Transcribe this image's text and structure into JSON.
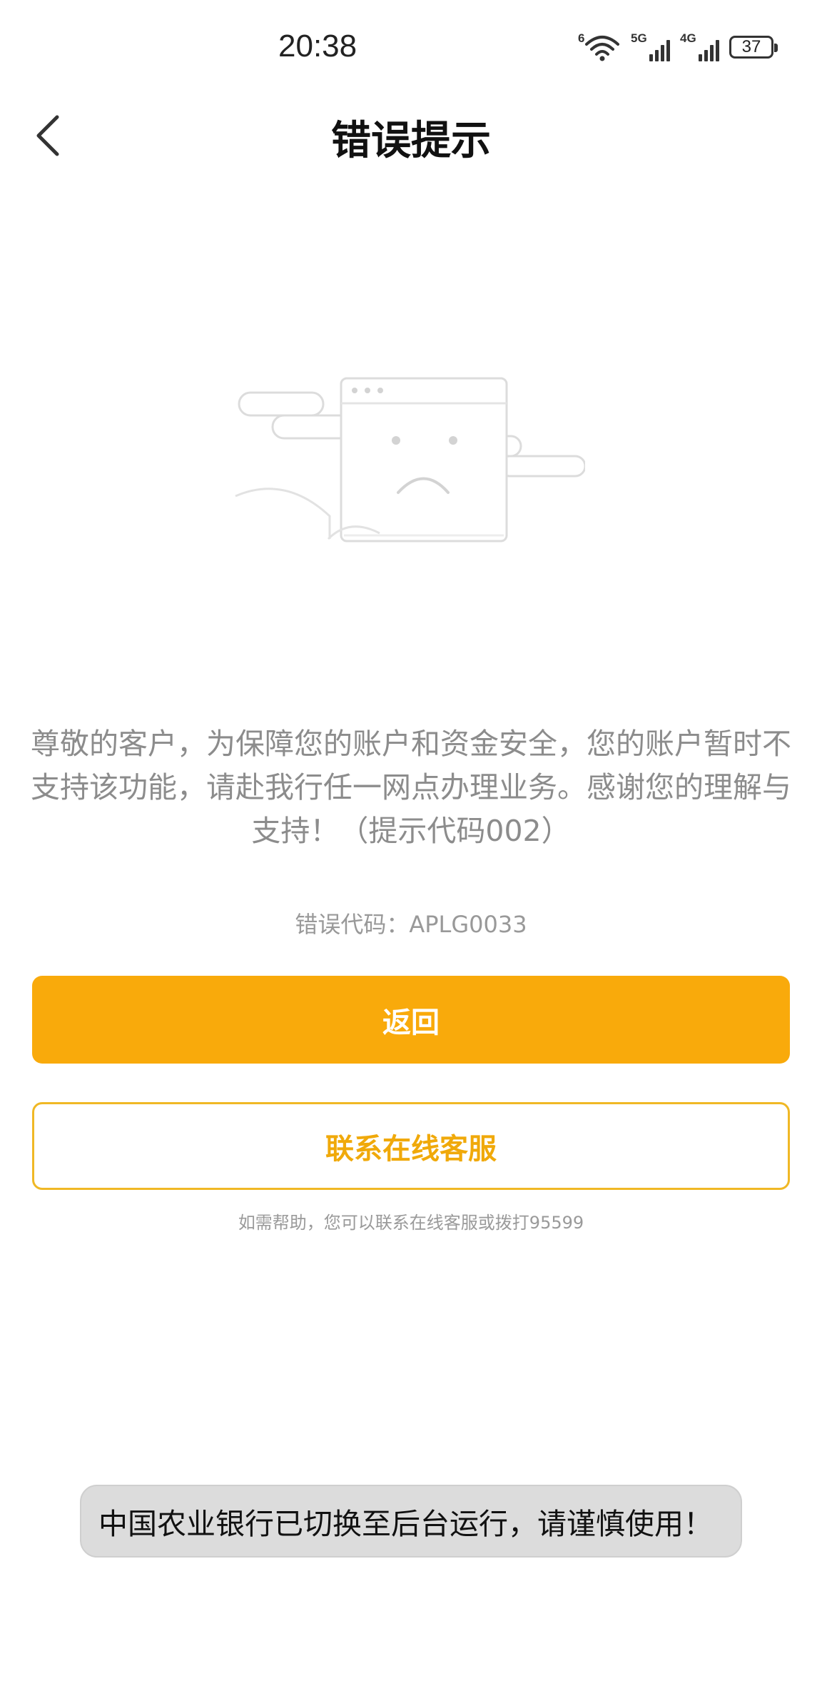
{
  "status_bar": {
    "time": "20:38",
    "wifi_label": "6",
    "sim1_label": "5G",
    "sim2_label": "4G",
    "battery": "37",
    "icons": [
      "wifi-icon",
      "signal-5g-icon",
      "signal-4g-icon",
      "battery-icon"
    ]
  },
  "nav": {
    "title": "错误提示",
    "back_icon": "chevron-left-icon"
  },
  "illustration": {
    "icon": "sad-browser-window-illustration"
  },
  "main": {
    "message": "尊敬的客户，为保障您的账户和资金安全，您的账户暂时不支持该功能，请赴我行任一网点办理业务。感谢您的理解与支持！（提示代码002）",
    "error_code": "错误代码：APLG0033"
  },
  "buttons": {
    "primary_label": "返回",
    "secondary_label": "联系在线客服"
  },
  "help_text": "如需帮助，您可以联系在线客服或拨打95599",
  "toast": {
    "text": "中国农业银行已切换至后台运行，请谨慎使用！"
  },
  "colors": {
    "accent": "#f9aa0b",
    "secondary_border": "#f0b825",
    "message_text": "#8c8c8c",
    "toast_bg": "#dcdcdc"
  }
}
